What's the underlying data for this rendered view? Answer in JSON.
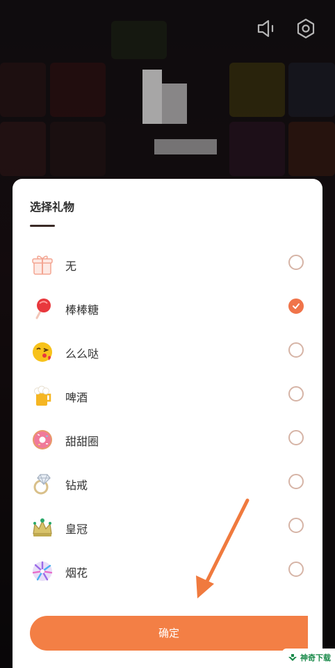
{
  "sheet": {
    "title": "选择礼物",
    "confirm_label": "确定"
  },
  "gifts": [
    {
      "label": "无",
      "icon": "gift-box-icon",
      "selected": false
    },
    {
      "label": "棒棒糖",
      "icon": "lollipop-icon",
      "selected": true
    },
    {
      "label": "么么哒",
      "icon": "kiss-emoji-icon",
      "selected": false
    },
    {
      "label": "啤酒",
      "icon": "beer-icon",
      "selected": false
    },
    {
      "label": "甜甜圈",
      "icon": "donut-icon",
      "selected": false
    },
    {
      "label": "钻戒",
      "icon": "diamond-ring-icon",
      "selected": false
    },
    {
      "label": "皇冠",
      "icon": "crown-icon",
      "selected": false
    },
    {
      "label": "烟花",
      "icon": "firework-icon",
      "selected": false
    }
  ],
  "watermark": {
    "text": "神奇下载"
  },
  "colors": {
    "accent": "#f37f45",
    "check": "#f0744a",
    "radio_border": "#d6b4a6"
  }
}
